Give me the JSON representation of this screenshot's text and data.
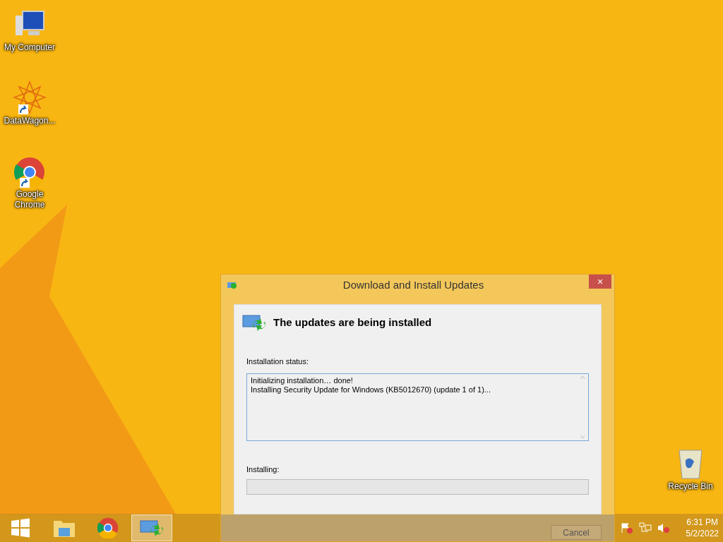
{
  "desktop_icons": [
    {
      "kind": "computer",
      "label": "My Computer",
      "shortcut": false
    },
    {
      "kind": "mandala",
      "label": "DataWagon...",
      "shortcut": true
    },
    {
      "kind": "chrome",
      "label": "Google Chrome",
      "shortcut": true
    },
    {
      "kind": "bin",
      "label": "Recycle Bin",
      "shortcut": false
    }
  ],
  "dialog": {
    "title": "Download and Install Updates",
    "close": "×",
    "heading": "The updates are being installed",
    "status_label": "Installation status:",
    "status_lines": [
      "Initializing installation… done!",
      "Installing Security Update for Windows (KB5012670) (update 1 of 1)..."
    ],
    "progress_label": "Installing:",
    "progress": {
      "level": 0
    },
    "cancel": "Cancel"
  },
  "taskbar": {
    "items": [
      {
        "kind": "start",
        "selected": false
      },
      {
        "kind": "explorer",
        "selected": false
      },
      {
        "kind": "chrome",
        "selected": false
      },
      {
        "kind": "update",
        "selected": true
      }
    ],
    "tray": [
      {
        "kind": "flag"
      },
      {
        "kind": "network"
      },
      {
        "kind": "volume"
      }
    ],
    "time": "6:31 PM",
    "date": "5/2/2022"
  }
}
